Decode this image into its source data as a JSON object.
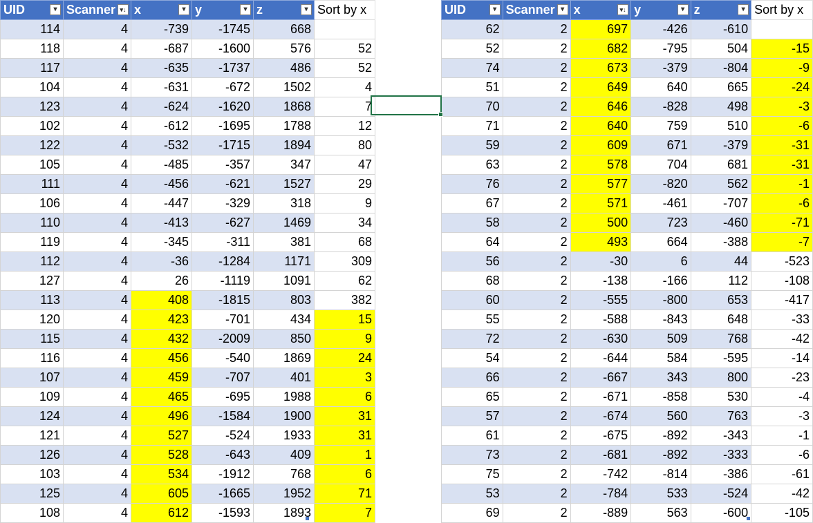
{
  "left_table": {
    "headers": [
      "UID",
      "Scanner",
      "x",
      "y",
      "z"
    ],
    "extra_header": "Sort by x",
    "rows": [
      {
        "uid": "114",
        "scanner": "4",
        "x": "-739",
        "y": "-1745",
        "z": "668",
        "sort": "",
        "hx": false,
        "hs": false
      },
      {
        "uid": "118",
        "scanner": "4",
        "x": "-687",
        "y": "-1600",
        "z": "576",
        "sort": "52",
        "hx": false,
        "hs": false
      },
      {
        "uid": "117",
        "scanner": "4",
        "x": "-635",
        "y": "-1737",
        "z": "486",
        "sort": "52",
        "hx": false,
        "hs": false
      },
      {
        "uid": "104",
        "scanner": "4",
        "x": "-631",
        "y": "-672",
        "z": "1502",
        "sort": "4",
        "hx": false,
        "hs": false
      },
      {
        "uid": "123",
        "scanner": "4",
        "x": "-624",
        "y": "-1620",
        "z": "1868",
        "sort": "7",
        "hx": false,
        "hs": false
      },
      {
        "uid": "102",
        "scanner": "4",
        "x": "-612",
        "y": "-1695",
        "z": "1788",
        "sort": "12",
        "hx": false,
        "hs": false
      },
      {
        "uid": "122",
        "scanner": "4",
        "x": "-532",
        "y": "-1715",
        "z": "1894",
        "sort": "80",
        "hx": false,
        "hs": false
      },
      {
        "uid": "105",
        "scanner": "4",
        "x": "-485",
        "y": "-357",
        "z": "347",
        "sort": "47",
        "hx": false,
        "hs": false
      },
      {
        "uid": "111",
        "scanner": "4",
        "x": "-456",
        "y": "-621",
        "z": "1527",
        "sort": "29",
        "hx": false,
        "hs": false
      },
      {
        "uid": "106",
        "scanner": "4",
        "x": "-447",
        "y": "-329",
        "z": "318",
        "sort": "9",
        "hx": false,
        "hs": false
      },
      {
        "uid": "110",
        "scanner": "4",
        "x": "-413",
        "y": "-627",
        "z": "1469",
        "sort": "34",
        "hx": false,
        "hs": false
      },
      {
        "uid": "119",
        "scanner": "4",
        "x": "-345",
        "y": "-311",
        "z": "381",
        "sort": "68",
        "hx": false,
        "hs": false
      },
      {
        "uid": "112",
        "scanner": "4",
        "x": "-36",
        "y": "-1284",
        "z": "1171",
        "sort": "309",
        "hx": false,
        "hs": false
      },
      {
        "uid": "127",
        "scanner": "4",
        "x": "26",
        "y": "-1119",
        "z": "1091",
        "sort": "62",
        "hx": false,
        "hs": false
      },
      {
        "uid": "113",
        "scanner": "4",
        "x": "408",
        "y": "-1815",
        "z": "803",
        "sort": "382",
        "hx": true,
        "hs": false
      },
      {
        "uid": "120",
        "scanner": "4",
        "x": "423",
        "y": "-701",
        "z": "434",
        "sort": "15",
        "hx": true,
        "hs": true
      },
      {
        "uid": "115",
        "scanner": "4",
        "x": "432",
        "y": "-2009",
        "z": "850",
        "sort": "9",
        "hx": true,
        "hs": true
      },
      {
        "uid": "116",
        "scanner": "4",
        "x": "456",
        "y": "-540",
        "z": "1869",
        "sort": "24",
        "hx": true,
        "hs": true
      },
      {
        "uid": "107",
        "scanner": "4",
        "x": "459",
        "y": "-707",
        "z": "401",
        "sort": "3",
        "hx": true,
        "hs": true
      },
      {
        "uid": "109",
        "scanner": "4",
        "x": "465",
        "y": "-695",
        "z": "1988",
        "sort": "6",
        "hx": true,
        "hs": true
      },
      {
        "uid": "124",
        "scanner": "4",
        "x": "496",
        "y": "-1584",
        "z": "1900",
        "sort": "31",
        "hx": true,
        "hs": true
      },
      {
        "uid": "121",
        "scanner": "4",
        "x": "527",
        "y": "-524",
        "z": "1933",
        "sort": "31",
        "hx": true,
        "hs": true
      },
      {
        "uid": "126",
        "scanner": "4",
        "x": "528",
        "y": "-643",
        "z": "409",
        "sort": "1",
        "hx": true,
        "hs": true
      },
      {
        "uid": "103",
        "scanner": "4",
        "x": "534",
        "y": "-1912",
        "z": "768",
        "sort": "6",
        "hx": true,
        "hs": true
      },
      {
        "uid": "125",
        "scanner": "4",
        "x": "605",
        "y": "-1665",
        "z": "1952",
        "sort": "71",
        "hx": true,
        "hs": true
      },
      {
        "uid": "108",
        "scanner": "4",
        "x": "612",
        "y": "-1593",
        "z": "1893",
        "sort": "7",
        "hx": true,
        "hs": true
      }
    ]
  },
  "right_table": {
    "headers": [
      "UID",
      "Scanner",
      "x",
      "y",
      "z"
    ],
    "extra_header": "Sort by x",
    "rows": [
      {
        "uid": "62",
        "scanner": "2",
        "x": "697",
        "y": "-426",
        "z": "-610",
        "sort": "",
        "hx": true,
        "hs": false
      },
      {
        "uid": "52",
        "scanner": "2",
        "x": "682",
        "y": "-795",
        "z": "504",
        "sort": "-15",
        "hx": true,
        "hs": true
      },
      {
        "uid": "74",
        "scanner": "2",
        "x": "673",
        "y": "-379",
        "z": "-804",
        "sort": "-9",
        "hx": true,
        "hs": true
      },
      {
        "uid": "51",
        "scanner": "2",
        "x": "649",
        "y": "640",
        "z": "665",
        "sort": "-24",
        "hx": true,
        "hs": true
      },
      {
        "uid": "70",
        "scanner": "2",
        "x": "646",
        "y": "-828",
        "z": "498",
        "sort": "-3",
        "hx": true,
        "hs": true
      },
      {
        "uid": "71",
        "scanner": "2",
        "x": "640",
        "y": "759",
        "z": "510",
        "sort": "-6",
        "hx": true,
        "hs": true
      },
      {
        "uid": "59",
        "scanner": "2",
        "x": "609",
        "y": "671",
        "z": "-379",
        "sort": "-31",
        "hx": true,
        "hs": true
      },
      {
        "uid": "63",
        "scanner": "2",
        "x": "578",
        "y": "704",
        "z": "681",
        "sort": "-31",
        "hx": true,
        "hs": true
      },
      {
        "uid": "76",
        "scanner": "2",
        "x": "577",
        "y": "-820",
        "z": "562",
        "sort": "-1",
        "hx": true,
        "hs": true
      },
      {
        "uid": "67",
        "scanner": "2",
        "x": "571",
        "y": "-461",
        "z": "-707",
        "sort": "-6",
        "hx": true,
        "hs": true
      },
      {
        "uid": "58",
        "scanner": "2",
        "x": "500",
        "y": "723",
        "z": "-460",
        "sort": "-71",
        "hx": true,
        "hs": true
      },
      {
        "uid": "64",
        "scanner": "2",
        "x": "493",
        "y": "664",
        "z": "-388",
        "sort": "-7",
        "hx": true,
        "hs": true
      },
      {
        "uid": "56",
        "scanner": "2",
        "x": "-30",
        "y": "6",
        "z": "44",
        "sort": "-523",
        "hx": false,
        "hs": false
      },
      {
        "uid": "68",
        "scanner": "2",
        "x": "-138",
        "y": "-166",
        "z": "112",
        "sort": "-108",
        "hx": false,
        "hs": false
      },
      {
        "uid": "60",
        "scanner": "2",
        "x": "-555",
        "y": "-800",
        "z": "653",
        "sort": "-417",
        "hx": false,
        "hs": false
      },
      {
        "uid": "55",
        "scanner": "2",
        "x": "-588",
        "y": "-843",
        "z": "648",
        "sort": "-33",
        "hx": false,
        "hs": false
      },
      {
        "uid": "72",
        "scanner": "2",
        "x": "-630",
        "y": "509",
        "z": "768",
        "sort": "-42",
        "hx": false,
        "hs": false
      },
      {
        "uid": "54",
        "scanner": "2",
        "x": "-644",
        "y": "584",
        "z": "-595",
        "sort": "-14",
        "hx": false,
        "hs": false
      },
      {
        "uid": "66",
        "scanner": "2",
        "x": "-667",
        "y": "343",
        "z": "800",
        "sort": "-23",
        "hx": false,
        "hs": false
      },
      {
        "uid": "65",
        "scanner": "2",
        "x": "-671",
        "y": "-858",
        "z": "530",
        "sort": "-4",
        "hx": false,
        "hs": false
      },
      {
        "uid": "57",
        "scanner": "2",
        "x": "-674",
        "y": "560",
        "z": "763",
        "sort": "-3",
        "hx": false,
        "hs": false
      },
      {
        "uid": "61",
        "scanner": "2",
        "x": "-675",
        "y": "-892",
        "z": "-343",
        "sort": "-1",
        "hx": false,
        "hs": false
      },
      {
        "uid": "73",
        "scanner": "2",
        "x": "-681",
        "y": "-892",
        "z": "-333",
        "sort": "-6",
        "hx": false,
        "hs": false
      },
      {
        "uid": "75",
        "scanner": "2",
        "x": "-742",
        "y": "-814",
        "z": "-386",
        "sort": "-61",
        "hx": false,
        "hs": false
      },
      {
        "uid": "53",
        "scanner": "2",
        "x": "-784",
        "y": "533",
        "z": "-524",
        "sort": "-42",
        "hx": false,
        "hs": false
      },
      {
        "uid": "69",
        "scanner": "2",
        "x": "-889",
        "y": "563",
        "z": "-600",
        "sort": "-105",
        "hx": false,
        "hs": false
      }
    ]
  },
  "sort_indicators": {
    "left_sorted_column": "Scanner",
    "right_sorted_column": "x"
  },
  "icons": {
    "filter": "filter-dropdown-icon",
    "sorted_filter": "sorted-filter-icon"
  },
  "colors": {
    "header_blue": "#4472c4",
    "band_blue": "#d9e1f2",
    "highlight_yellow": "#ffff00",
    "selection_green": "#217346"
  }
}
